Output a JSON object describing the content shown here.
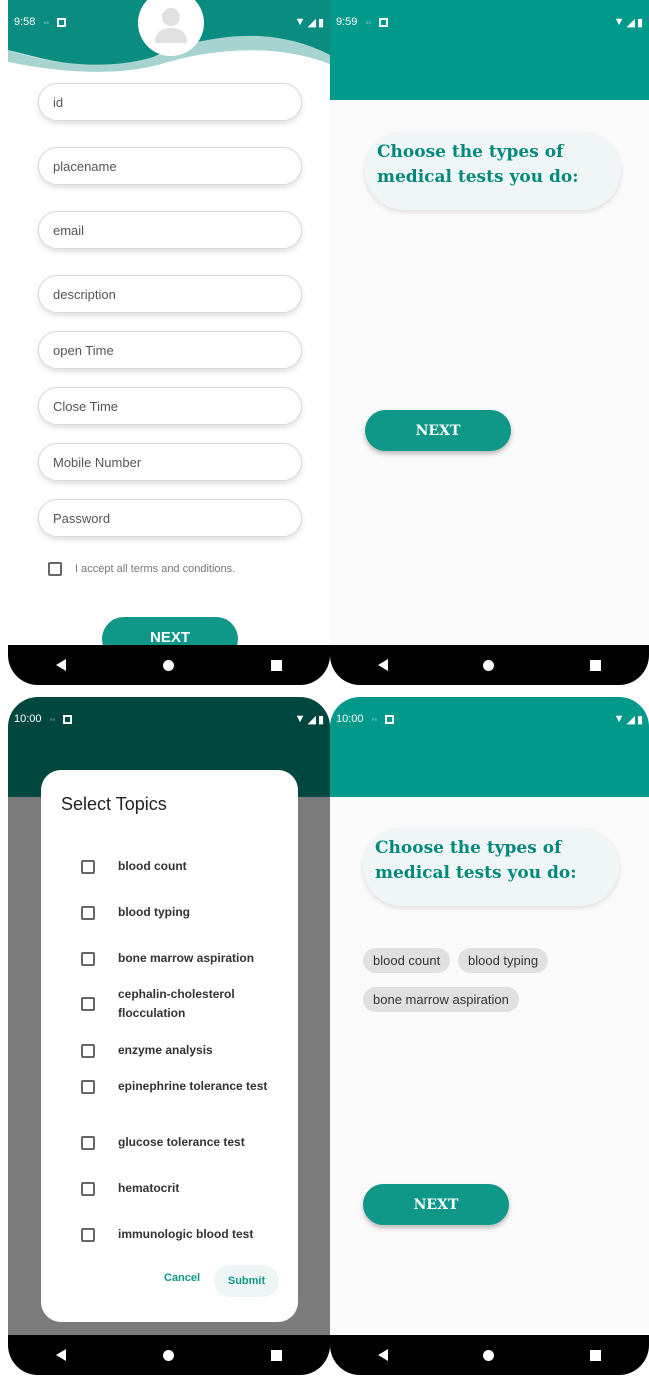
{
  "screens": {
    "registration": {
      "status_time": "9:58",
      "fields": [
        {
          "placeholder": "id"
        },
        {
          "placeholder": "placename"
        },
        {
          "placeholder": "email"
        },
        {
          "placeholder": "description"
        },
        {
          "placeholder": "open Time"
        },
        {
          "placeholder": "Close Time"
        },
        {
          "placeholder": "Mobile Number"
        },
        {
          "placeholder": "Password"
        }
      ],
      "terms_label": "I accept all terms and conditions.",
      "next_label": "NEXT"
    },
    "tests_empty": {
      "status_time": "9:59",
      "prompt": "Choose the types of medical tests you do:",
      "next_label": "NEXT"
    },
    "topics_dialog": {
      "status_time": "10:00",
      "title": "Select Topics",
      "options": [
        {
          "label": "blood count"
        },
        {
          "label": "blood typing"
        },
        {
          "label": "bone marrow aspiration"
        },
        {
          "label": "cephalin-cholesterol flocculation"
        },
        {
          "label": "enzyme analysis"
        },
        {
          "label": "epinephrine tolerance test"
        },
        {
          "label": "glucose tolerance test"
        },
        {
          "label": "hematocrit"
        },
        {
          "label": "immunologic blood test"
        }
      ],
      "cancel_label": "Cancel",
      "submit_label": "Submit"
    },
    "tests_selected": {
      "status_time": "10:00",
      "prompt": "Choose the types of medical tests you do:",
      "chips": [
        {
          "label": "blood count"
        },
        {
          "label": "blood typing"
        },
        {
          "label": "bone marrow aspiration"
        }
      ],
      "next_label": "NEXT"
    }
  },
  "colors": {
    "primary": "#00998a",
    "primary_dark": "#00473f",
    "button": "#0f9787",
    "scrim": "#7b7b7b"
  },
  "icons": {
    "avatar": "user-avatar-icon",
    "back": "back-triangle-icon",
    "home": "home-circle-icon",
    "recent": "recent-square-icon"
  }
}
